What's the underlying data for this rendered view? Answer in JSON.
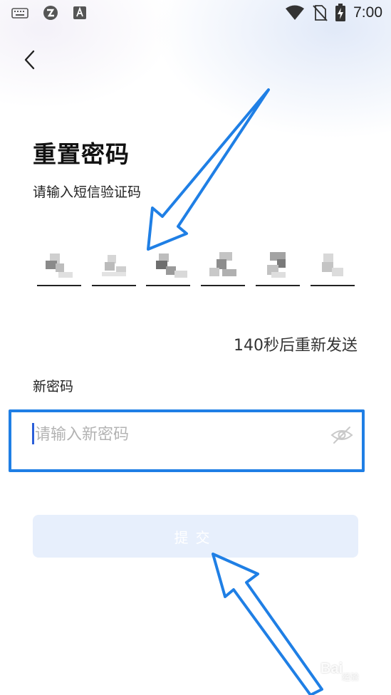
{
  "status_bar": {
    "time": "7:00",
    "left_icons": [
      "keyboard-icon",
      "app-icon",
      "font-a-icon"
    ],
    "right_icons": [
      "wifi-icon",
      "no-sim-icon",
      "battery-charging-icon"
    ]
  },
  "header": {
    "back_icon": "chevron-left-icon",
    "title": "重置密码"
  },
  "sms_code": {
    "label": "请输入短信验证码",
    "digit_count": 6,
    "digits": [
      "",
      "",
      "",
      "",
      "",
      ""
    ]
  },
  "resend": {
    "text": "140秒后重新发送"
  },
  "new_password": {
    "label": "新密码",
    "placeholder": "请输入新密码",
    "value": "",
    "toggle_icon": "eye-hidden-icon"
  },
  "submit": {
    "label": "提交"
  },
  "watermark": {
    "text": "Bai",
    "subtext": "经验"
  },
  "colors": {
    "annotation_blue": "#1f7fe5",
    "submit_bg": "#e7effc",
    "caret": "#2b5fd9"
  }
}
